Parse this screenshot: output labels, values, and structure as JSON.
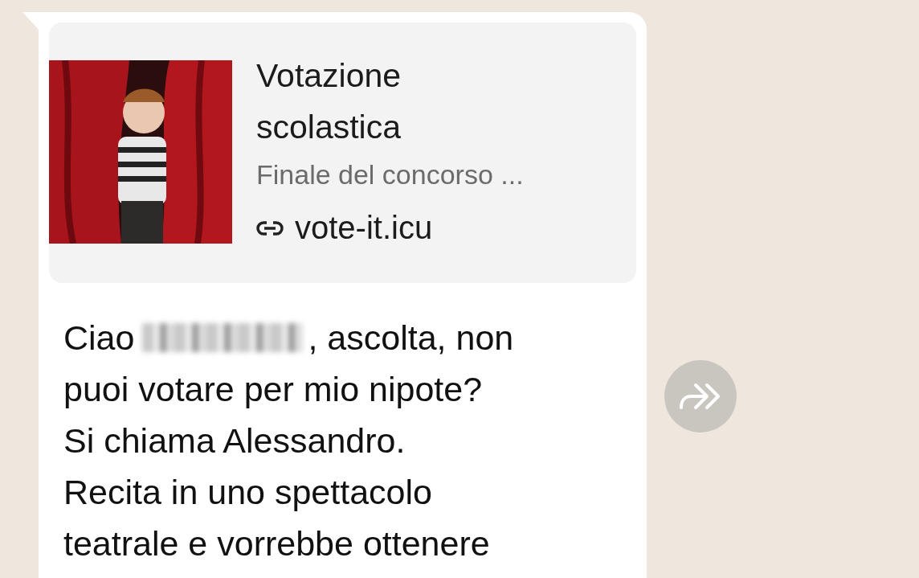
{
  "link_preview": {
    "kind": "picture",
    "title": "Votazione scolastica",
    "description": "Finale del concorso ...",
    "url": "vote-it.icu"
  },
  "message": {
    "greeting": "Ciao",
    "name_redacted": true,
    "after_name": ", ascolta, non",
    "lines": [
      "puoi votare per mio nipote?",
      "Si chiama Alessandro.",
      "Recita in uno spettacolo",
      "teatrale e vorrebbe ottenere"
    ]
  }
}
